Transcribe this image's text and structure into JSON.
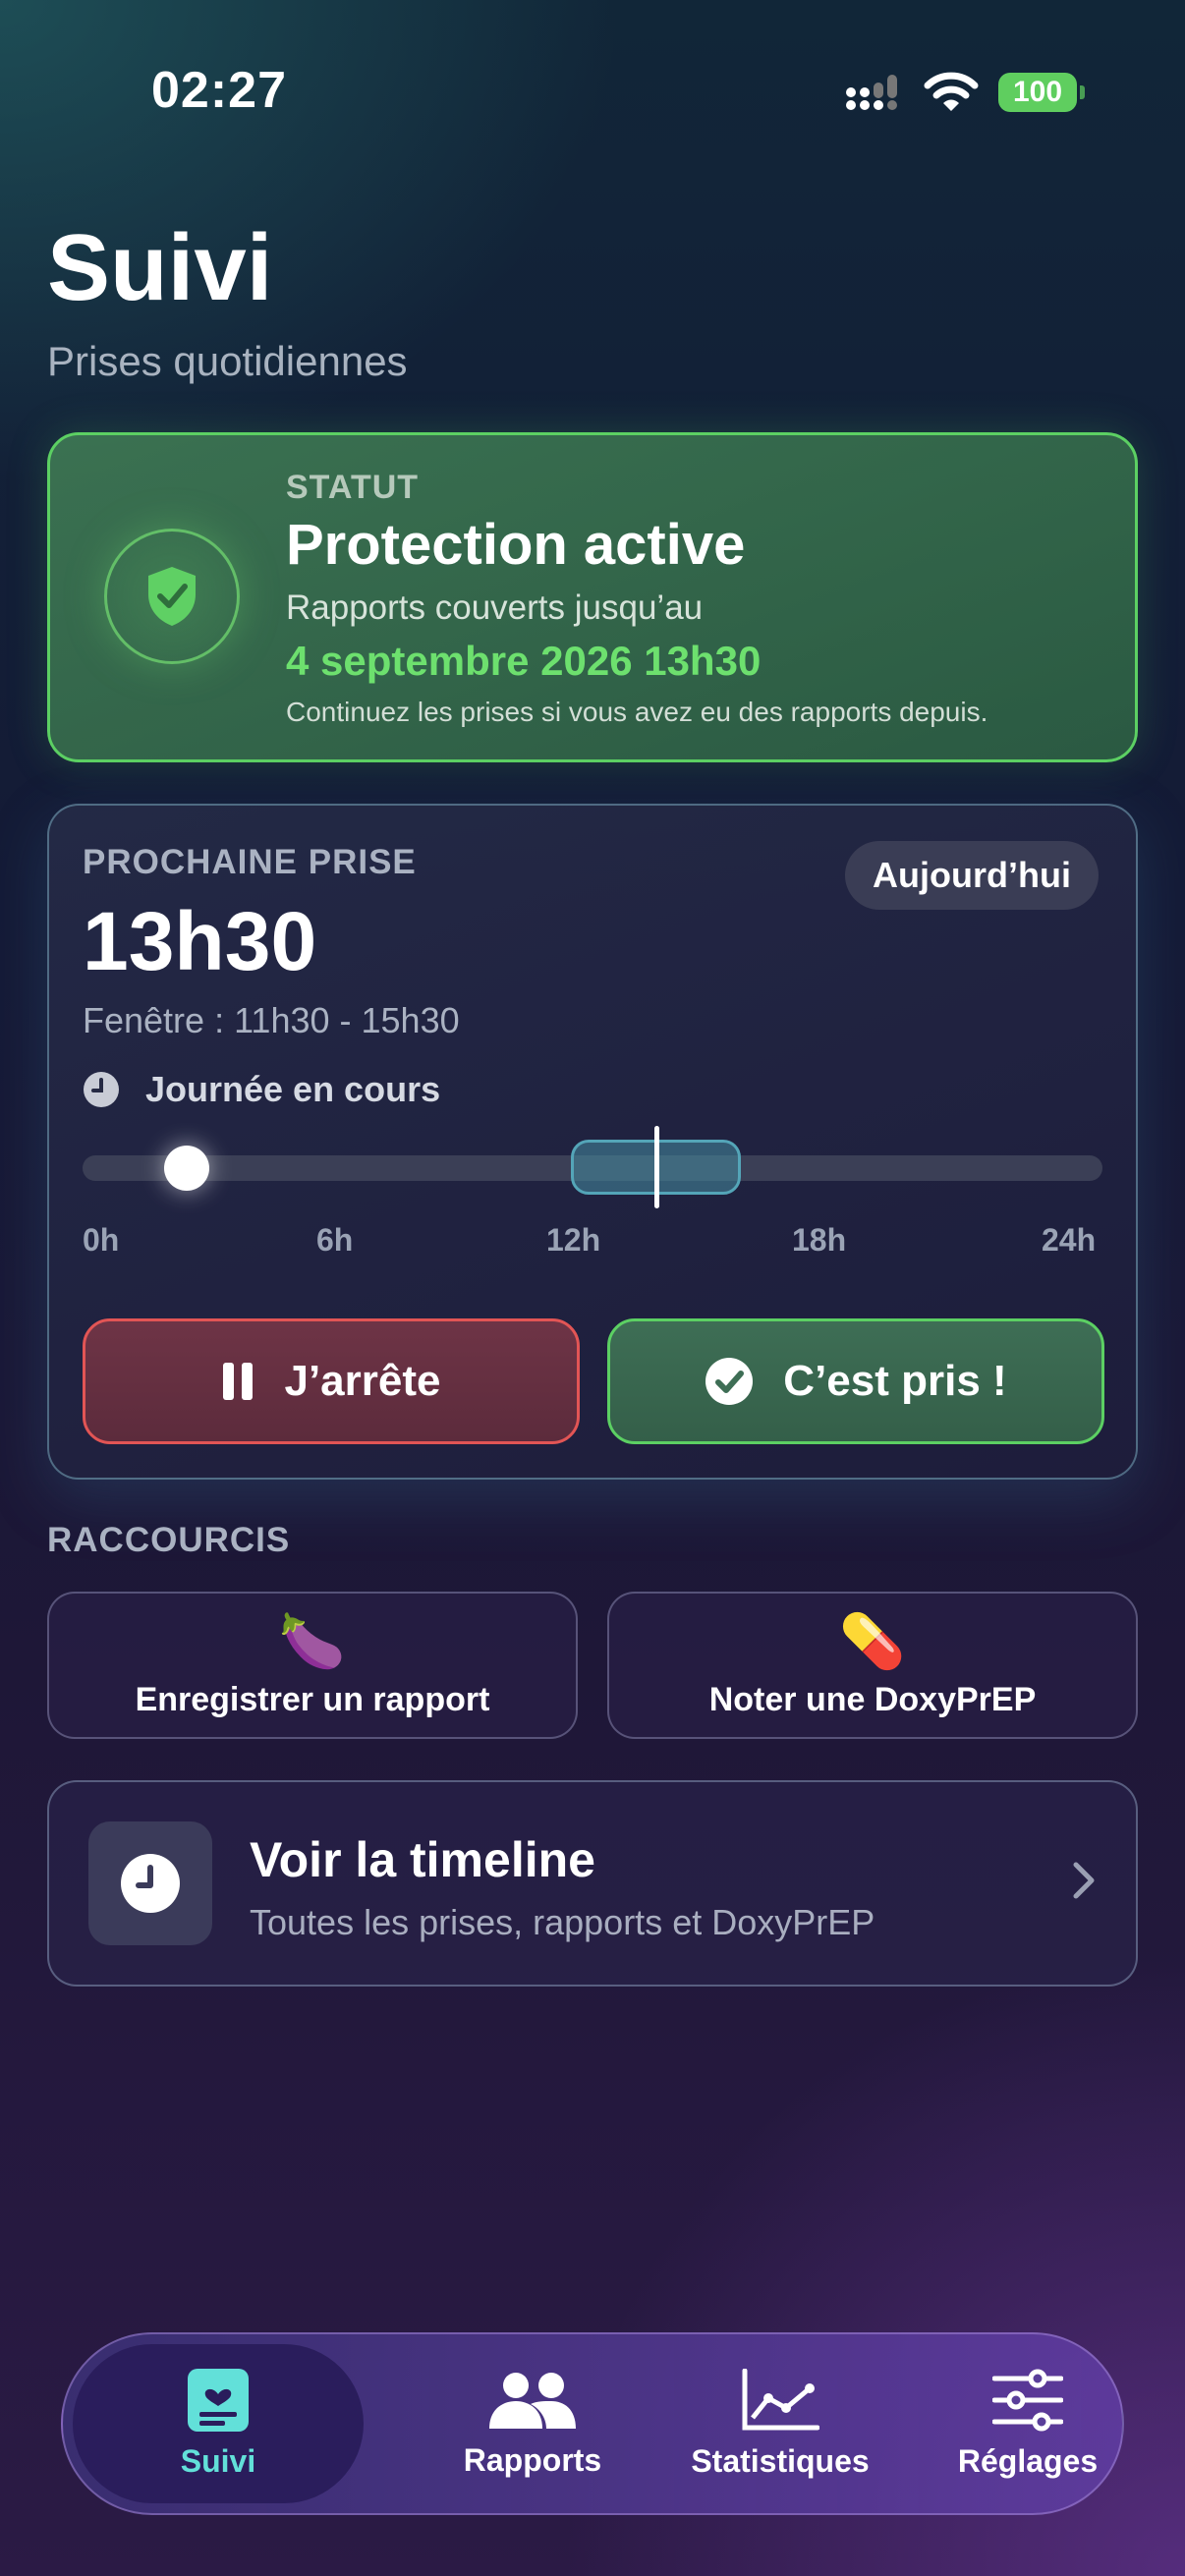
{
  "status_bar": {
    "time": "02:27",
    "battery": "100"
  },
  "header": {
    "title": "Suivi",
    "subtitle": "Prises quotidiennes"
  },
  "status_card": {
    "label": "STATUT",
    "title": "Protection active",
    "line": "Rapports couverts jusqu’au",
    "date": "4 septembre 2026 13h30",
    "note": "Continuez les prises si vous avez eu des rapports depuis."
  },
  "next_dose": {
    "label": "PROCHAINE PRISE",
    "day_chip": "Aujourd’hui",
    "time": "13h30",
    "window": "Fenêtre : 11h30 - 15h30",
    "day_status": "Journée en cours",
    "ticks": [
      "0h",
      "6h",
      "12h",
      "18h",
      "24h"
    ],
    "current_hour": 2.45,
    "window_start_hour": 11.5,
    "window_end_hour": 15.5,
    "dose_hour": 13.5,
    "stop_label": "J’arrête",
    "taken_label": "C’est pris !"
  },
  "shortcuts": {
    "label": "RACCOURCIS",
    "items": [
      {
        "emoji": "🍆",
        "label": "Enregistrer un rapport"
      },
      {
        "emoji": "💊",
        "label": "Noter une DoxyPrEP"
      }
    ]
  },
  "timeline": {
    "title": "Voir la timeline",
    "subtitle": "Toutes les prises, rapports et DoxyPrEP"
  },
  "tabbar": {
    "items": [
      {
        "label": "Suivi",
        "active": true
      },
      {
        "label": "Rapports",
        "active": false
      },
      {
        "label": "Statistiques",
        "active": false
      },
      {
        "label": "Réglages",
        "active": false
      }
    ]
  },
  "colors": {
    "accent_green": "#5cd063",
    "accent_red": "#e25555",
    "accent_teal": "#62e0d9"
  }
}
